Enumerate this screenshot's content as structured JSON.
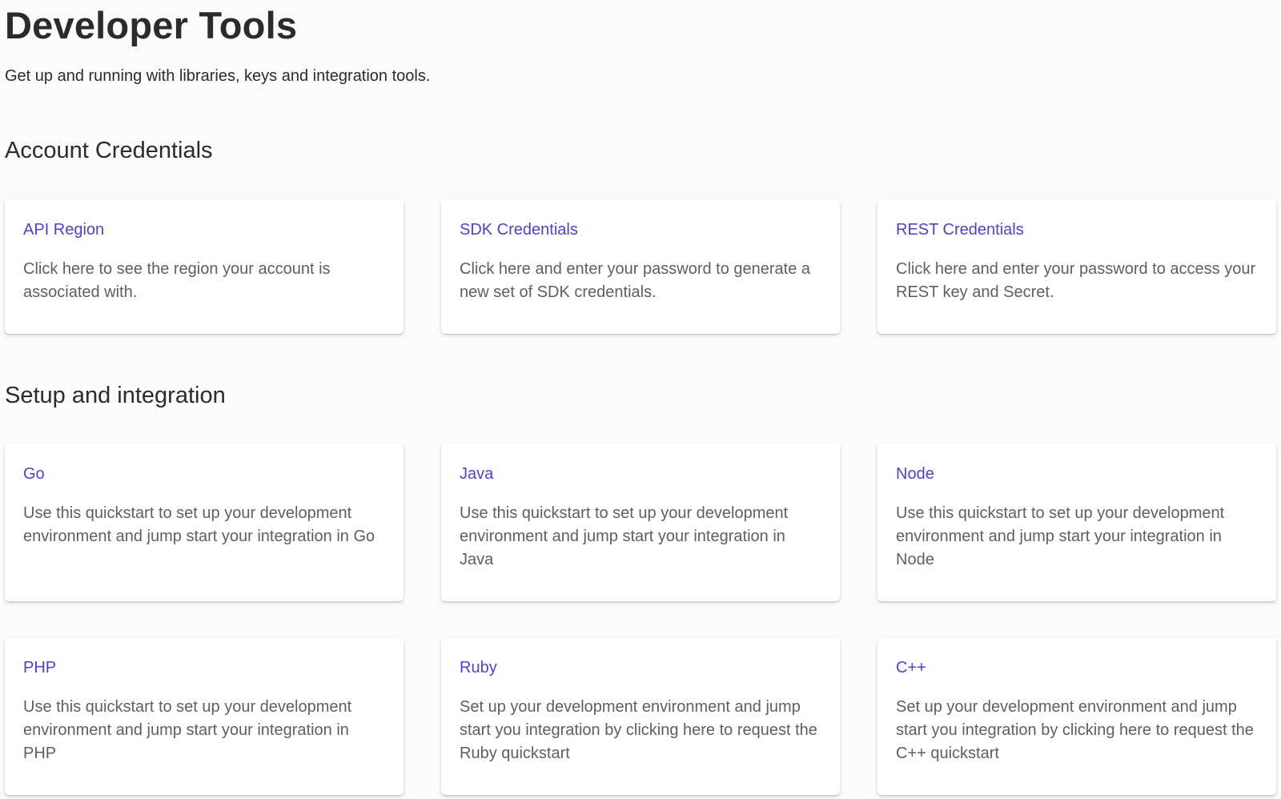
{
  "header": {
    "title": "Developer Tools",
    "subtitle": "Get up and running with libraries, keys and integration tools."
  },
  "sections": [
    {
      "title": "Account Credentials",
      "cards": [
        {
          "title": "API Region",
          "description": "Click here to see the region your account is associated with."
        },
        {
          "title": "SDK Credentials",
          "description": "Click here and enter your password to generate a new set of SDK credentials."
        },
        {
          "title": "REST Credentials",
          "description": "Click here and enter your password to access your REST key and Secret."
        }
      ]
    },
    {
      "title": "Setup and integration",
      "cards": [
        {
          "title": "Go",
          "description": "Use this quickstart to set up your development environment and jump start your integration in Go"
        },
        {
          "title": "Java",
          "description": "Use this quickstart to set up your development environment and jump start your integration in Java"
        },
        {
          "title": "Node",
          "description": "Use this quickstart to set up your development environment and jump start your integration in Node"
        },
        {
          "title": "PHP",
          "description": "Use this quickstart to set up your development environment and jump start your integration in PHP"
        },
        {
          "title": "Ruby",
          "description": "Set up your development environment and jump start you integration by clicking here to request the Ruby quickstart"
        },
        {
          "title": "C++",
          "description": "Set up your development environment and jump start you integration by clicking here to request the C++ quickstart"
        }
      ]
    }
  ],
  "colors": {
    "background": "#fbfbfe",
    "card_background": "#ffffff",
    "link_accent": "#4a43d6",
    "heading_text": "#2b2b2b",
    "body_text": "#5f5f5f"
  }
}
